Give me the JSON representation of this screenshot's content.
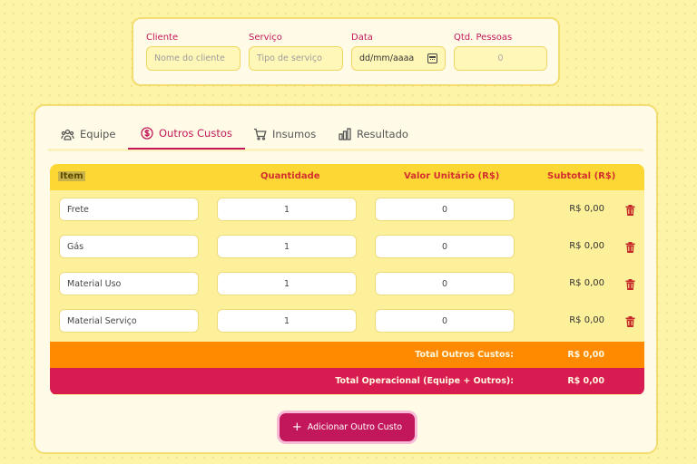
{
  "form": {
    "cliente": {
      "label": "Cliente",
      "placeholder": "Nome do cliente"
    },
    "servico": {
      "label": "Serviço",
      "placeholder": "Tipo de serviço"
    },
    "data": {
      "label": "Data",
      "value": "dd/mm/aaaa"
    },
    "pessoas": {
      "label": "Qtd. Pessoas",
      "value": "0"
    }
  },
  "tabs": [
    {
      "label": "Equipe",
      "icon": "team-icon"
    },
    {
      "label": "Outros Custos",
      "icon": "dollar-circle-icon",
      "active": true
    },
    {
      "label": "Insumos",
      "icon": "cart-icon"
    },
    {
      "label": "Resultado",
      "icon": "bar-chart-icon"
    }
  ],
  "table": {
    "headers": {
      "item": "Item",
      "quantidade": "Quantidade",
      "valor": "Valor Unitário (R$)",
      "subtotal": "Subtotal (R$)"
    },
    "rows": [
      {
        "item": "Frete",
        "quantidade": "1",
        "valor": "0",
        "subtotal": "R$ 0,00"
      },
      {
        "item": "Gás",
        "quantidade": "1",
        "valor": "0",
        "subtotal": "R$ 0,00"
      },
      {
        "item": "Material Uso",
        "quantidade": "1",
        "valor": "0",
        "subtotal": "R$ 0,00"
      },
      {
        "item": "Material Serviço",
        "quantidade": "1",
        "valor": "0",
        "subtotal": "R$ 0,00"
      }
    ],
    "total_outros": {
      "label": "Total Outros Custos:",
      "value": "R$ 0,00"
    },
    "total_operacional": {
      "label": "Total Operacional (Equipe + Outros):",
      "value": "R$ 0,00"
    }
  },
  "add_button": {
    "label": "Adicionar Outro Custo",
    "icon": "plus-icon"
  },
  "colors": {
    "accent": "#c2185b",
    "header": "#fdd835",
    "total_outros": "#ff8a00",
    "total_operacional": "#d81b50",
    "background": "#fdf4a8"
  }
}
